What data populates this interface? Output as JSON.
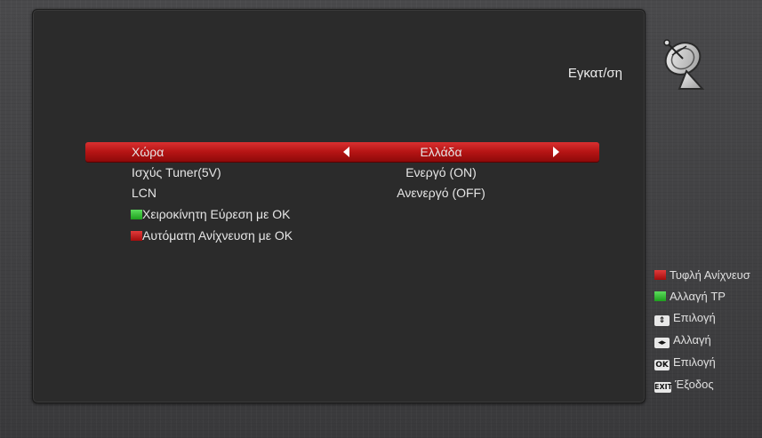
{
  "header": {
    "title": "Εγκατ/ση",
    "icon": "satellite-dish-icon"
  },
  "menu": {
    "rows": [
      {
        "label": "Χώρα",
        "value": "Ελλάδα",
        "selected": true
      },
      {
        "label": "Ισχύς Tuner(5V)",
        "value": "Ενεργό (ON)"
      },
      {
        "label": "LCN",
        "value": "Ανενεργό (OFF)"
      },
      {
        "label": "Χειροκίνητη Εύρεση με OK",
        "color_key": "green"
      },
      {
        "label": "Αυτόματη Ανίχνευση με OK",
        "color_key": "red"
      }
    ]
  },
  "hints": [
    {
      "key": "red",
      "label": "Τυφλή Ανίχνευσ"
    },
    {
      "key": "green",
      "label": "Αλλαγή TP"
    },
    {
      "key": "up-down",
      "label": "Επιλογή"
    },
    {
      "key": "left-right",
      "label": "Αλλαγή"
    },
    {
      "key": "OK",
      "label": "Επιλογή"
    },
    {
      "key": "EXIT",
      "label": "Έξοδος"
    }
  ],
  "colors": {
    "accent_red": "#c41b1b",
    "green_key": "#2fb52f",
    "panel": "#2b2b2b"
  }
}
